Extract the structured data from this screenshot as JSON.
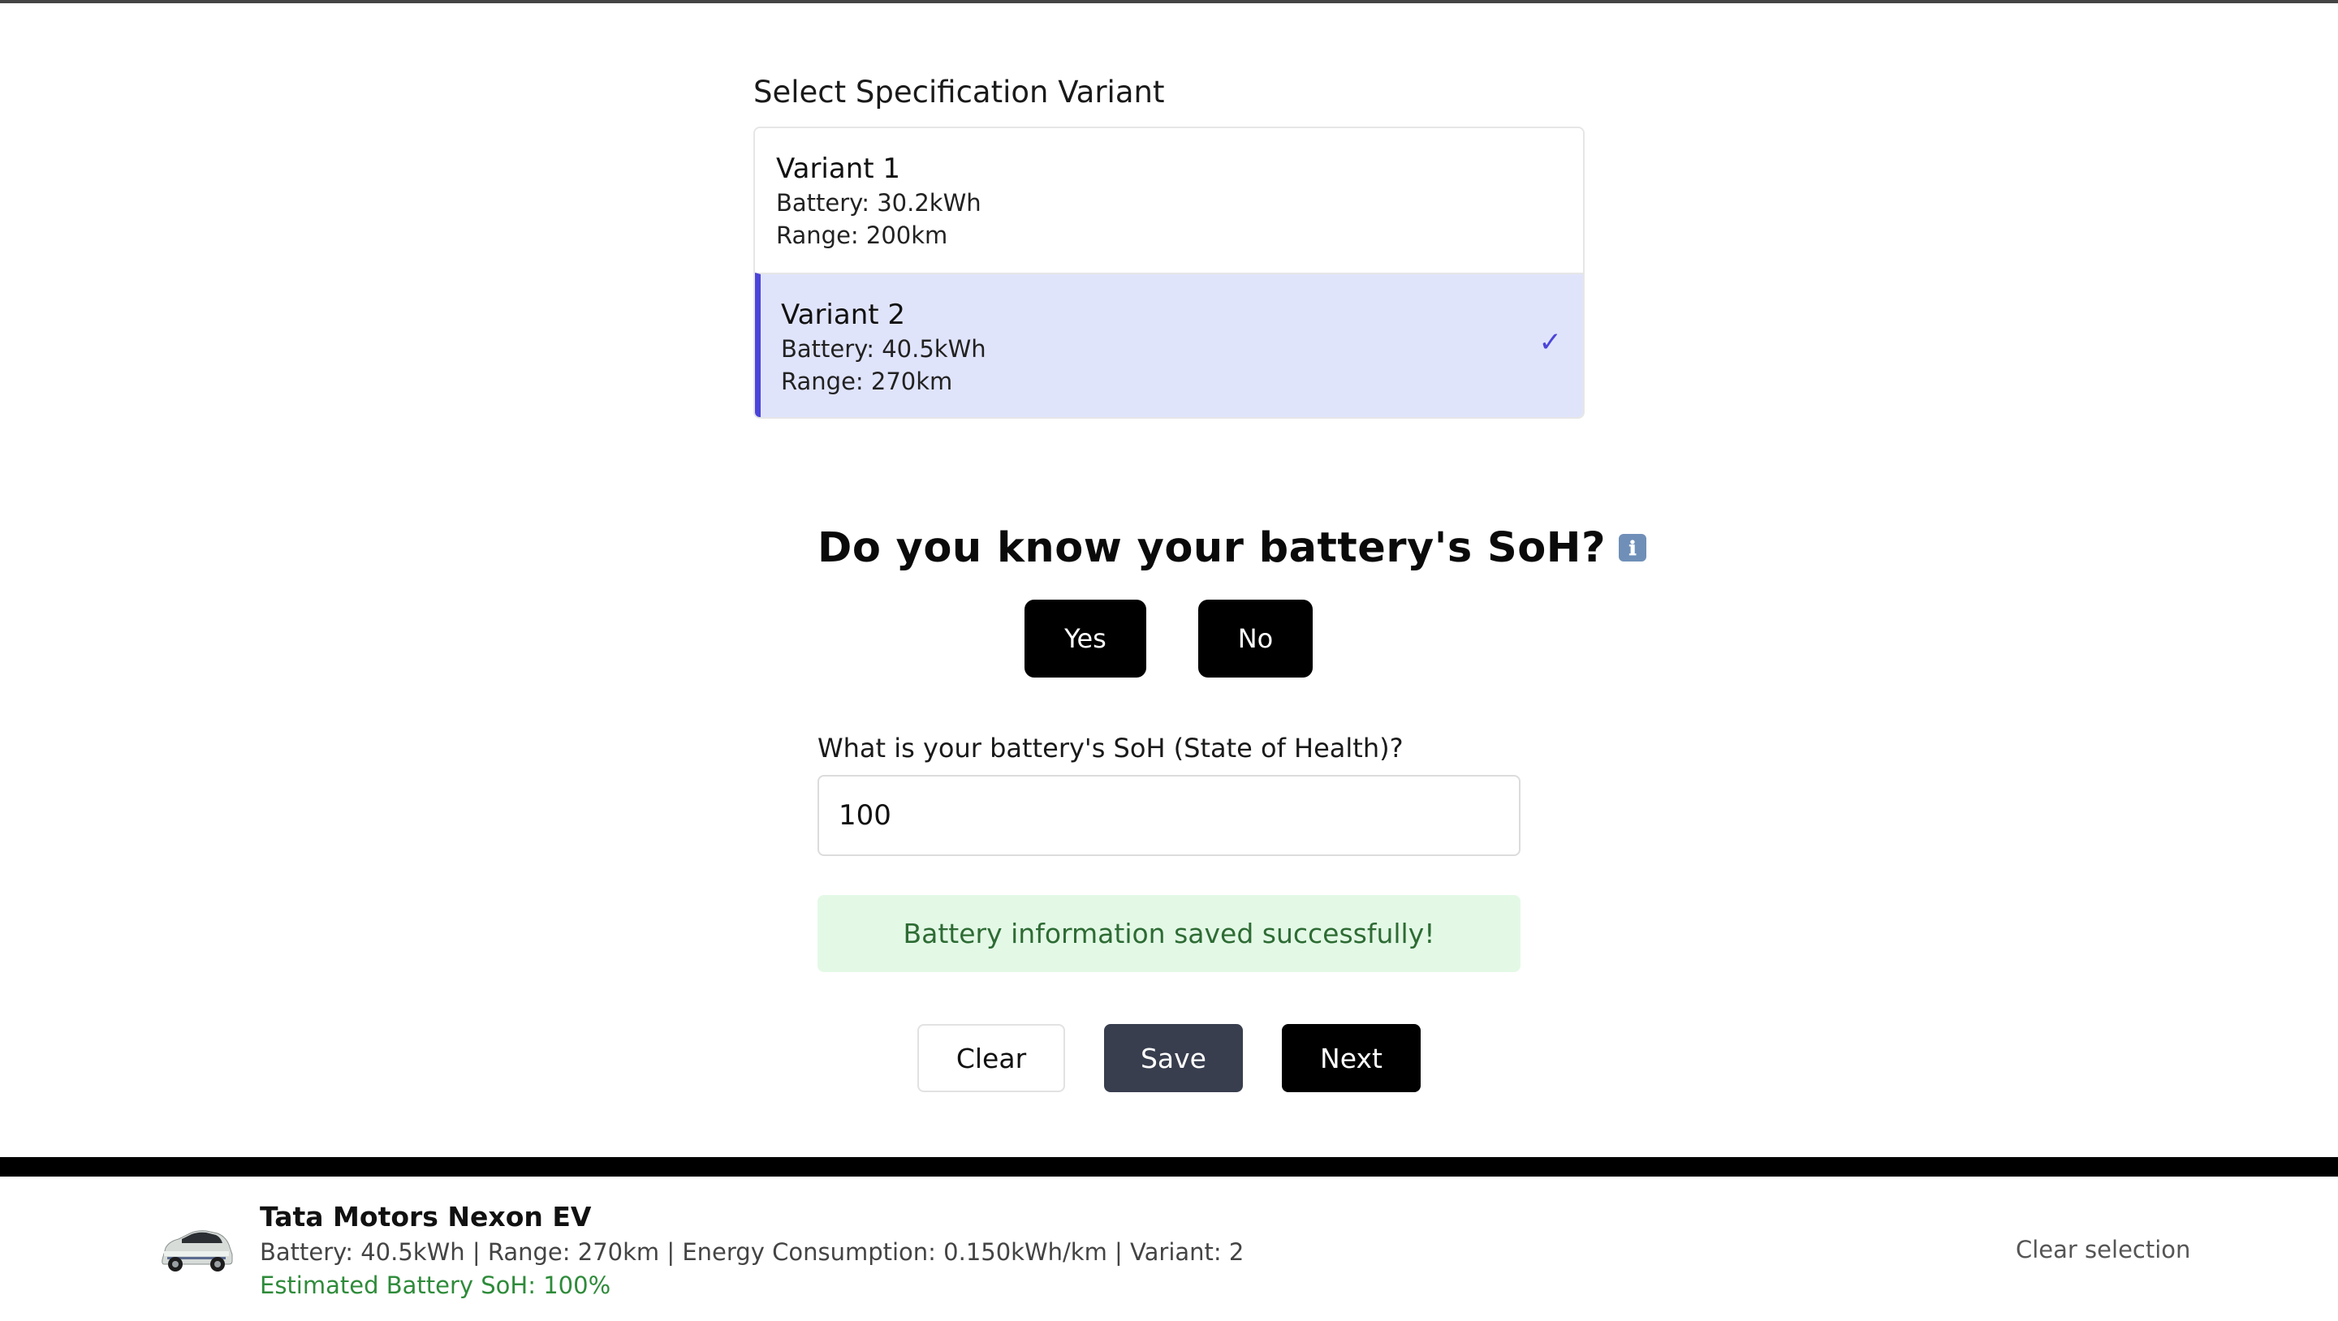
{
  "variant_section": {
    "title": "Select Specification Variant",
    "variants": [
      {
        "name": "Variant 1",
        "battery": "Battery: 30.2kWh",
        "range": "Range: 200km",
        "selected": false
      },
      {
        "name": "Variant 2",
        "battery": "Battery: 40.5kWh",
        "range": "Range: 270km",
        "selected": true
      }
    ],
    "selected_mark": "✓"
  },
  "soh_question": {
    "heading": "Do you know your battery's SoH?",
    "info_icon": "ℹ",
    "yes_label": "Yes",
    "no_label": "No",
    "field_label": "What is your battery's SoH (State of Health)?",
    "field_value": "100"
  },
  "status": {
    "message": "Battery information saved successfully!"
  },
  "actions": {
    "clear_label": "Clear",
    "save_label": "Save",
    "next_label": "Next"
  },
  "footer": {
    "title": "Tata Motors Nexon EV",
    "specs": "Battery: 40.5kWh | Range: 270km | Energy Consumption: 0.150kWh/km | Variant: 2",
    "estimated_soh": "Estimated Battery SoH: 100%",
    "clear_selection_label": "Clear selection"
  },
  "colors": {
    "accent": "#4b45d9",
    "selected_bg": "#e0e4fb",
    "success_bg": "#e3f9e6",
    "success_text": "#2e6b34",
    "soh_text": "#2e8b3a",
    "save_button": "#383e4e"
  }
}
